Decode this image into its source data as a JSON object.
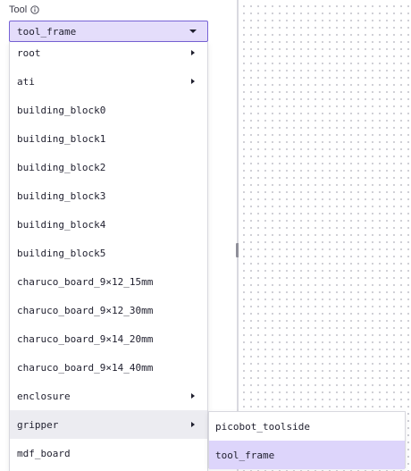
{
  "tool_field": {
    "label": "Tool",
    "info_icon": "info-circle-icon",
    "selected_value": "tool_frame",
    "caret_icon": "caret-down-icon"
  },
  "menu": {
    "items": [
      {
        "label": "root",
        "has_submenu": true
      },
      {
        "label": "ati",
        "has_submenu": true
      },
      {
        "label": "building_block0",
        "has_submenu": false
      },
      {
        "label": "building_block1",
        "has_submenu": false
      },
      {
        "label": "building_block2",
        "has_submenu": false
      },
      {
        "label": "building_block3",
        "has_submenu": false
      },
      {
        "label": "building_block4",
        "has_submenu": false
      },
      {
        "label": "building_block5",
        "has_submenu": false
      },
      {
        "label": "charuco_board_9×12_15mm",
        "has_submenu": false
      },
      {
        "label": "charuco_board_9×12_30mm",
        "has_submenu": false
      },
      {
        "label": "charuco_board_9×14_20mm",
        "has_submenu": false
      },
      {
        "label": "charuco_board_9×14_40mm",
        "has_submenu": false
      },
      {
        "label": "enclosure",
        "has_submenu": true
      },
      {
        "label": "gripper",
        "has_submenu": true,
        "hovered": true
      },
      {
        "label": "mdf_board",
        "has_submenu": false
      }
    ]
  },
  "submenu": {
    "items": [
      {
        "label": "picobot_toolside",
        "selected": false
      },
      {
        "label": "tool_frame",
        "selected": true
      }
    ]
  },
  "colors": {
    "accent": "#7762d6",
    "select_bg": "#e4ddfb",
    "selected_item_bg": "#ddd5fb",
    "hover_bg": "#ececf1"
  }
}
